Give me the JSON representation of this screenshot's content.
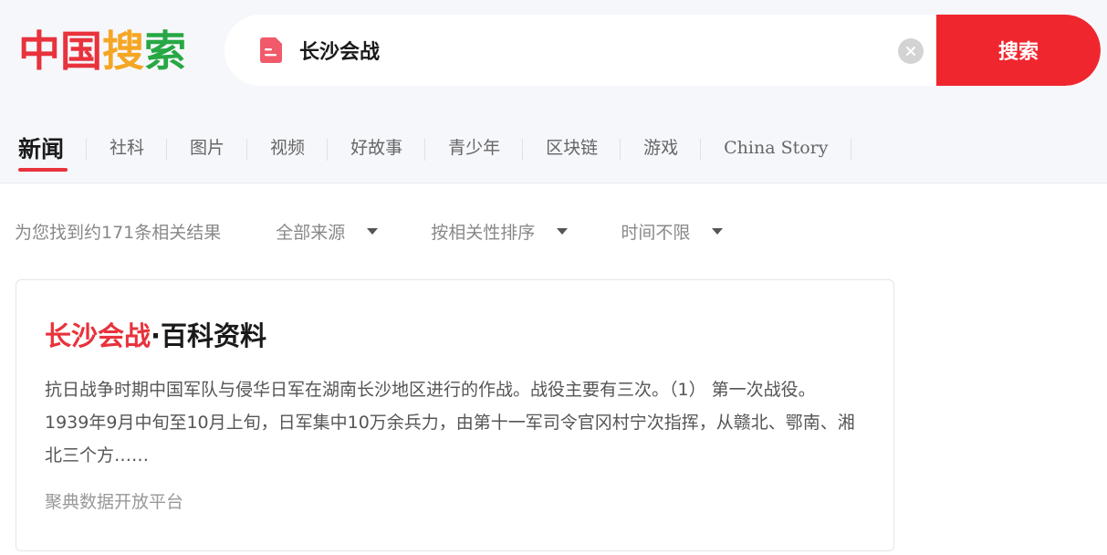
{
  "logo": {
    "chars": [
      "中",
      "国",
      "搜",
      "索"
    ],
    "colors": [
      "#e8323c",
      "#e8323c",
      "#f5a623",
      "#27a844"
    ]
  },
  "search": {
    "value": "长沙会战",
    "placeholder": "",
    "icon": "document-icon",
    "clear_icon": "close-circle-icon",
    "button_label": "搜索",
    "accent": "#f0262f"
  },
  "tabs": [
    {
      "label": "新闻",
      "active": true
    },
    {
      "label": "社科",
      "active": false
    },
    {
      "label": "图片",
      "active": false
    },
    {
      "label": "视频",
      "active": false
    },
    {
      "label": "好故事",
      "active": false
    },
    {
      "label": "青少年",
      "active": false
    },
    {
      "label": "区块链",
      "active": false
    },
    {
      "label": "游戏",
      "active": false
    },
    {
      "label": "China Story",
      "active": false
    }
  ],
  "filters": {
    "result_count": "为您找到约171条相关结果",
    "source": "全部来源",
    "sort": "按相关性排序",
    "time": "时间不限"
  },
  "results": [
    {
      "title_highlight": "长沙会战",
      "title_rest": "·百科资料",
      "snippet": "抗日战争时期中国军队与侵华日军在湖南长沙地区进行的作战。战役主要有三次。（1） 第一次战役。1939年9月中旬至10月上旬，日军集中10万余兵力，由第十一军司令官冈村宁次指挥，从赣北、鄂南、湘北三个方……",
      "source": "聚典数据开放平台"
    }
  ]
}
